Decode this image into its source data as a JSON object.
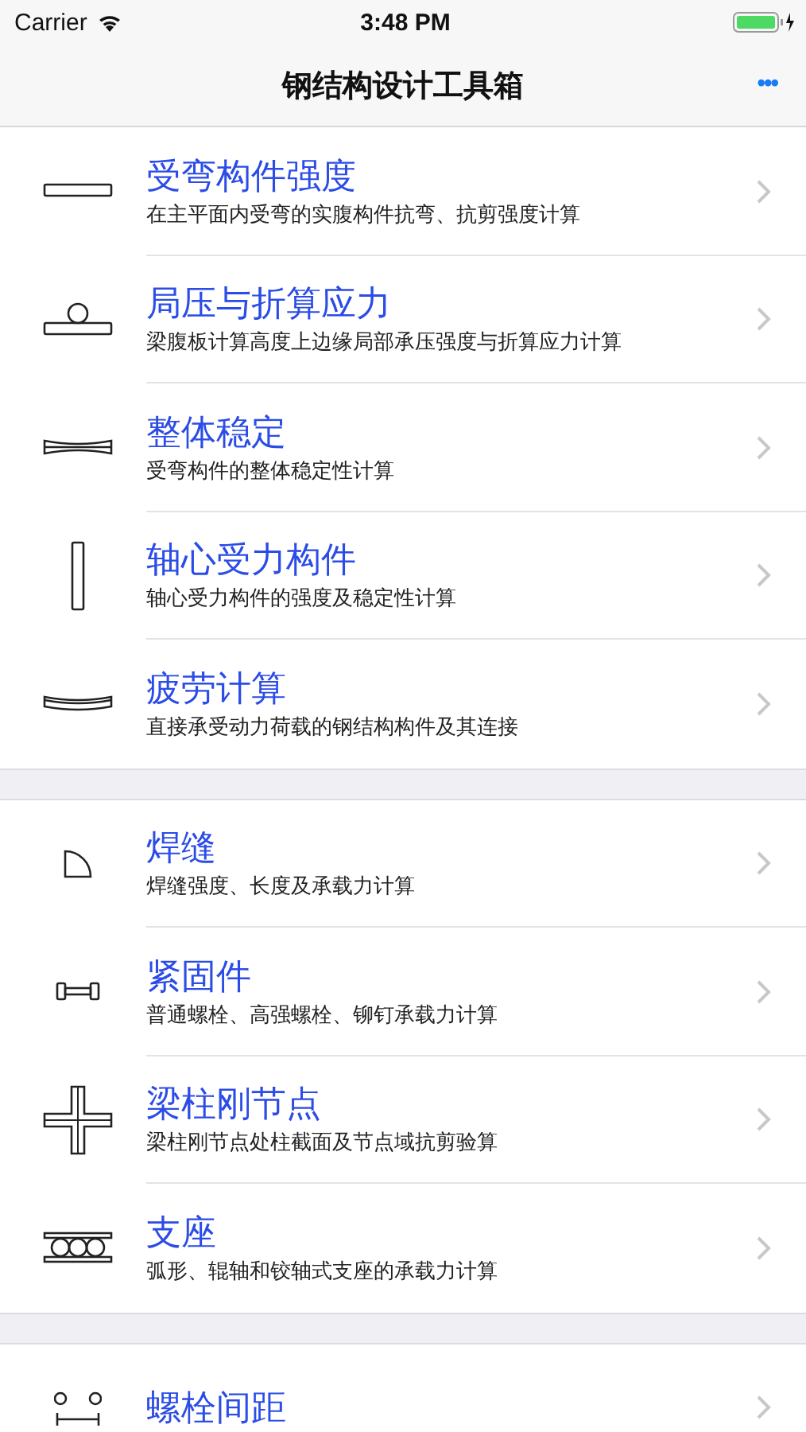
{
  "status_bar": {
    "carrier": "Carrier",
    "time": "3:48 PM"
  },
  "nav_bar": {
    "title": "钢结构设计工具箱",
    "menu": "•••"
  },
  "sections": [
    {
      "items": [
        {
          "kind": "beam",
          "title": "受弯构件强度",
          "subtitle": "在主平面内受弯的实腹构件抗弯、抗剪强度计算"
        },
        {
          "kind": "local",
          "title": "局压与折算应力",
          "subtitle": "梁腹板计算高度上边缘局部承压强度与折算应力计算"
        },
        {
          "kind": "stability",
          "title": "整体稳定",
          "subtitle": "受弯构件的整体稳定性计算"
        },
        {
          "kind": "column",
          "title": "轴心受力构件",
          "subtitle": "轴心受力构件的强度及稳定性计算"
        },
        {
          "kind": "fatigue",
          "title": "疲劳计算",
          "subtitle": "直接承受动力荷载的钢结构构件及其连接"
        }
      ]
    },
    {
      "items": [
        {
          "kind": "weld",
          "title": "焊缝",
          "subtitle": "焊缝强度、长度及承载力计算"
        },
        {
          "kind": "bolt",
          "title": "紧固件",
          "subtitle": "普通螺栓、高强螺栓、铆钉承载力计算"
        },
        {
          "kind": "joint",
          "title": "梁柱刚节点",
          "subtitle": "梁柱刚节点处柱截面及节点域抗剪验算"
        },
        {
          "kind": "bearing",
          "title": "支座",
          "subtitle": "弧形、辊轴和铰轴式支座的承载力计算"
        }
      ]
    },
    {
      "items": [
        {
          "kind": "spacing",
          "title": "螺栓间距"
        }
      ]
    }
  ]
}
